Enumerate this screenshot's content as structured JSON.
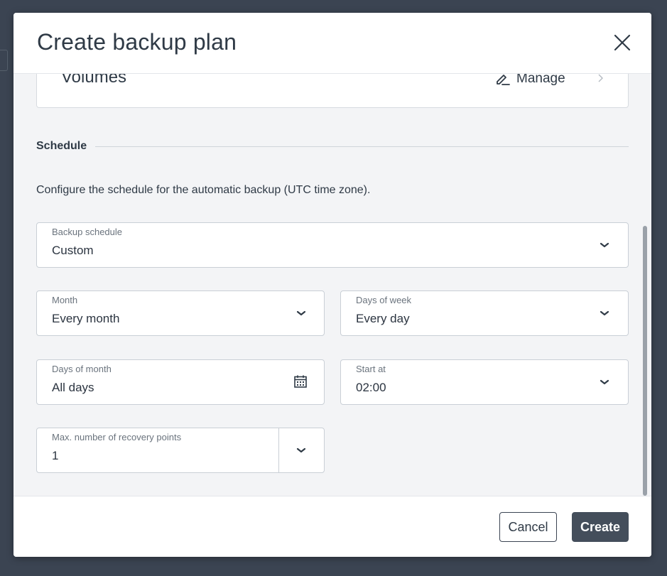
{
  "dialog": {
    "title": "Create backup plan",
    "close_icon": "close-icon"
  },
  "resource_card": {
    "title": "Volumes",
    "manage_label": "Manage",
    "manage_icon": "pencil-icon",
    "chevron_icon": "chevron-right-icon"
  },
  "schedule": {
    "section_title": "Schedule",
    "description": "Configure the schedule for the automatic backup (UTC time zone).",
    "backup_schedule": {
      "label": "Backup schedule",
      "value": "Custom"
    },
    "month": {
      "label": "Month",
      "value": "Every month"
    },
    "days_of_week": {
      "label": "Days of week",
      "value": "Every day"
    },
    "days_of_month": {
      "label": "Days of month",
      "value": "All days",
      "icon": "calendar-icon"
    },
    "start_at": {
      "label": "Start at",
      "value": "02:00"
    },
    "recovery_points": {
      "label": "Max. number of recovery points",
      "value": "1"
    }
  },
  "footer": {
    "cancel_label": "Cancel",
    "create_label": "Create"
  },
  "colors": {
    "backdrop": "#3b4452",
    "primary_button": "#444e5b",
    "body_background": "#f3f4f6"
  }
}
